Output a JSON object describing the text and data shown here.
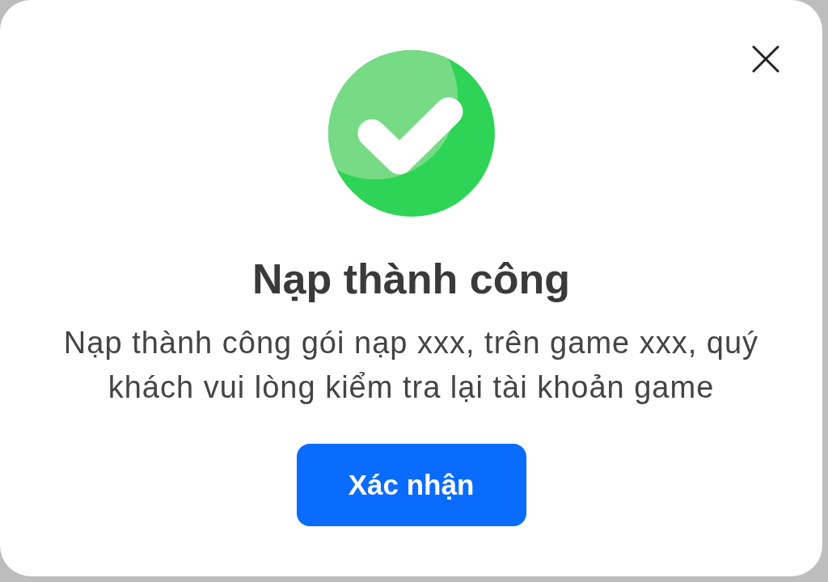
{
  "dialog": {
    "title": "Nạp thành công",
    "message": "Nạp thành công gói nạp xxx, trên game xxx, quý khách vui lòng kiểm tra lại tài khoản game",
    "buttons": [
      {
        "label": "Xác nhận"
      }
    ]
  }
}
